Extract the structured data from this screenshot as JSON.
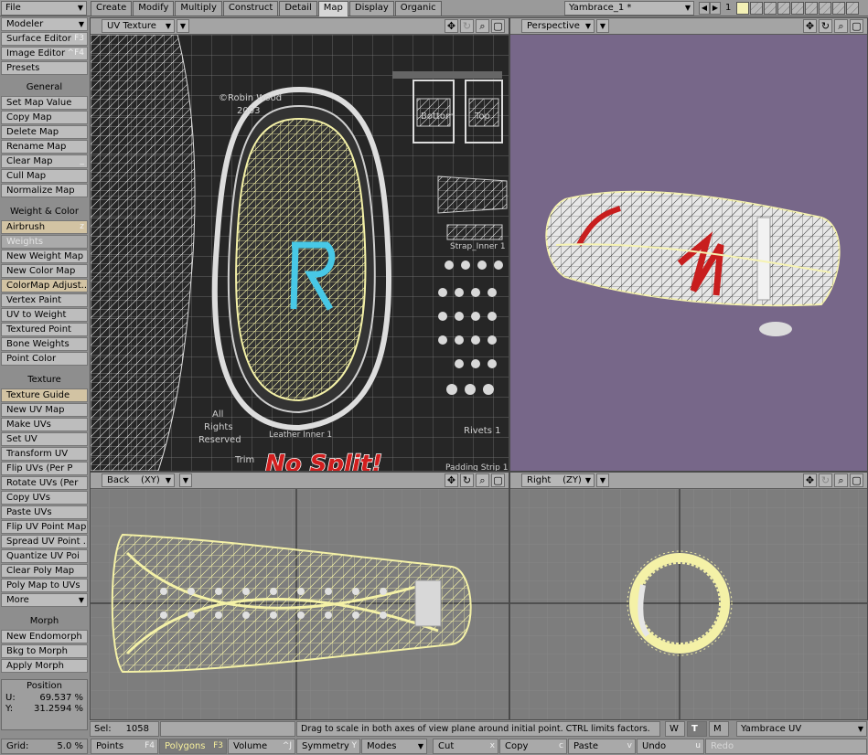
{
  "topbar": {
    "file_menu": "File",
    "tabs": [
      "Create",
      "Modify",
      "Multiply",
      "Construct",
      "Detail",
      "Map",
      "Display",
      "Organic"
    ],
    "active_tab": "Map",
    "object_name": "Yambrace_1 *",
    "layer_number": "1"
  },
  "toolbar": {
    "top_items": [
      {
        "label": "Modeler",
        "key": ""
      },
      {
        "label": "Surface Editor",
        "key": "F3"
      },
      {
        "label": "Image Editor",
        "key": "^F4"
      },
      {
        "label": "Presets",
        "key": ""
      }
    ],
    "general_header": "General",
    "general_items": [
      "Set Map Value",
      "Copy Map",
      "Delete Map",
      "Rename Map",
      "Clear Map",
      "Cull Map",
      "Normalize Map"
    ],
    "clear_map_key": "_",
    "weight_header": "Weight & Color",
    "weight_items": [
      {
        "label": "Airbrush",
        "key": "z"
      },
      {
        "label": "Weights",
        "key": ""
      },
      {
        "label": "New Weight Map",
        "key": ""
      },
      {
        "label": "New Color Map",
        "key": ""
      },
      {
        "label": "ColorMap Adjust...",
        "key": ""
      },
      {
        "label": "Vertex Paint",
        "key": ""
      },
      {
        "label": "UV to Weight",
        "key": ""
      },
      {
        "label": "Textured Point",
        "key": ""
      },
      {
        "label": "Bone Weights",
        "key": ""
      },
      {
        "label": "Point Color",
        "key": ""
      }
    ],
    "texture_header": "Texture",
    "texture_items": [
      "Texture Guide",
      "New UV Map",
      "Make UVs",
      "Set UV",
      "Transform UV",
      "Flip UVs (Per P",
      "Rotate UVs (Per",
      "Copy UVs",
      "Paste UVs",
      "Flip UV Point Map",
      "Spread UV Point ...",
      "Quantize UV Poi",
      "Clear Poly Map",
      "Poly Map to UVs"
    ],
    "more_label": "More",
    "morph_header": "Morph",
    "morph_items": [
      "New Endomorph",
      "Bkg to Morph",
      "Apply Morph"
    ]
  },
  "position": {
    "title": "Position",
    "u_label": "U:",
    "u_value": "69.537 %",
    "v_label": "Y:",
    "v_value": "31.2594 %"
  },
  "grid": {
    "label": "Grid:",
    "value": "5.0 %"
  },
  "viewports": {
    "uv": {
      "view": "UV Texture",
      "credit": "©Robin Wood\n2003",
      "annotation": "No Split!",
      "labels": [
        "Bottom",
        "Top",
        "Strap_Inner 1",
        "All",
        "Rights",
        "Reserved",
        "Leather Inner 1",
        "Rivets 1",
        "Trim",
        "Padding Strip 1"
      ]
    },
    "perspective": {
      "view": "Perspective",
      "bg_color": "#776789"
    },
    "back": {
      "view": "Back",
      "axes": "(XY)"
    },
    "right": {
      "view": "Right",
      "axes": "(ZY)"
    }
  },
  "status": {
    "sel_label": "Sel:",
    "sel_value": "1058",
    "hint": "Drag to scale in both axes of view plane around initial point. CTRL limits factors.",
    "map_w": "W",
    "map_t": "T",
    "map_m": "M",
    "vmap": "Yambrace UV"
  },
  "bottombar": {
    "points": {
      "label": "Points",
      "key": "F4"
    },
    "polygons": {
      "label": "Polygons",
      "key": "F3"
    },
    "volume": {
      "label": "Volume",
      "key": "^J"
    },
    "symmetry": {
      "label": "Symmetry",
      "key": "Y"
    },
    "modes": "Modes",
    "cut": {
      "label": "Cut",
      "key": "x"
    },
    "copy": {
      "label": "Copy",
      "key": "c"
    },
    "paste": {
      "label": "Paste",
      "key": "v"
    },
    "undo": {
      "label": "Undo",
      "key": "u"
    },
    "redo": {
      "label": "Redo",
      "key": ""
    }
  }
}
